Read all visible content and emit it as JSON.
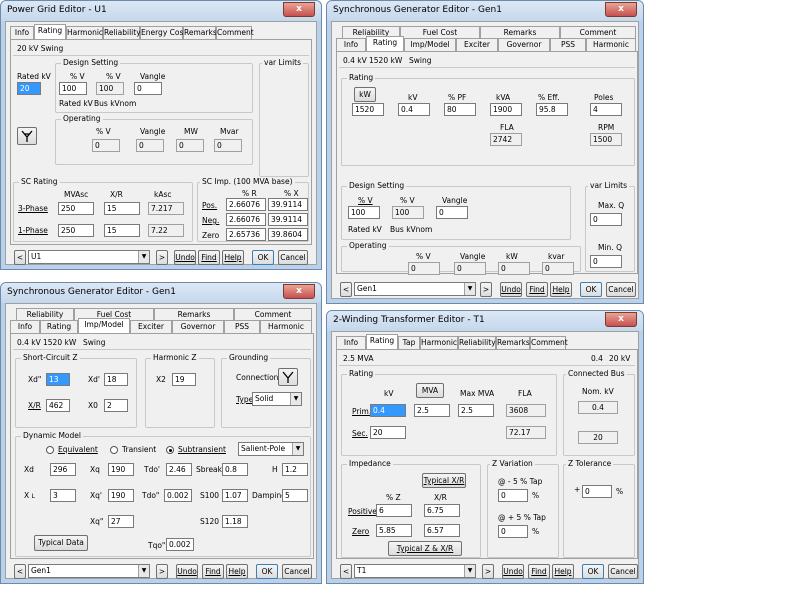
{
  "pg": {
    "title": "Power Grid Editor - U1",
    "close": "x",
    "tabs": [
      "Info",
      "Rating",
      "Harmonic",
      "Reliability",
      "Energy Cost",
      "Remarks",
      "Comment"
    ],
    "header": "20 kV  Swing",
    "rated_kv_label": "Rated kV",
    "rated_kv": "20",
    "design_setting": "Design Setting",
    "pct_v_label": "% V",
    "pct_v2_label": "% V",
    "vangle_label": "Vangle",
    "design_v": "100",
    "design_v2": "100",
    "design_vangle": "0",
    "rated_kv_sub": "Rated kV",
    "bus_kvnom": "Bus kVnom",
    "var_limits": "var Limits",
    "operating": "Operating",
    "op_pct_v": "% V",
    "op_vangle": "Vangle",
    "op_mw": "MW",
    "op_mvar": "Mvar",
    "op_v": "0",
    "op_vang": "0",
    "op_mw_val": "0",
    "op_mvar_val": "0",
    "sc_rating": "SC Rating",
    "mvasc": "MVAsc",
    "xr": "X/R",
    "kasc": "kAsc",
    "three_phase": "3-Phase",
    "three_mvasc": "250",
    "three_xr": "15",
    "three_kasc": "7.217",
    "one_phase": "1-Phase",
    "one_mvasc": "250",
    "one_xr": "15",
    "one_kasc": "7.22",
    "sc_imp": "SC Imp. (100 MVA base)",
    "pct_r": "% R",
    "pct_x": "% X",
    "pos": "Pos.",
    "pos_r": "2.66076",
    "pos_x": "39.9114",
    "neg": "Neg.",
    "neg_r": "2.66076",
    "neg_x": "39.9114",
    "zero": "Zero",
    "zero_r": "2.65736",
    "zero_x": "39.8604",
    "id": "U1",
    "nav_prev": "<",
    "nav_next": ">",
    "undo": "Undo",
    "find": "Find",
    "help": "Help",
    "ok": "OK",
    "cancel": "Cancel"
  },
  "sg1": {
    "title": "Synchronous Generator Editor - Gen1",
    "close": "x",
    "tabs_top": [
      "Reliability",
      "Fuel Cost",
      "Remarks",
      "Comment"
    ],
    "tabs_bottom": [
      "Info",
      "Rating",
      "Imp/Model",
      "Exciter",
      "Governor",
      "PSS",
      "Harmonic"
    ],
    "header_kv": "0.4 kV",
    "header_kw": "1520 kW",
    "header_mode": "Swing",
    "rating": "Rating",
    "kw_btn": "kW",
    "kv_label": "kV",
    "pf_label": "% PF",
    "kva_label": "kVA",
    "eff_label": "% Eff.",
    "poles_label": "Poles",
    "kw": "1520",
    "kv": "0.4",
    "pf": "80",
    "kva": "1900",
    "eff": "95.8",
    "poles": "4",
    "fla_label": "FLA",
    "fla": "2742",
    "rpm_label": "RPM",
    "rpm": "1500",
    "design_setting": "Design Setting",
    "pct_v": "% V",
    "pct_v2": "% V",
    "vangle": "Vangle",
    "dv": "100",
    "dv2": "100",
    "dvang": "0",
    "rated_kv": "Rated kV",
    "bus_kvnom": "Bus kVnom",
    "var_limits": "var Limits",
    "maxq_label": "Max. Q",
    "maxq": "0",
    "minq_label": "Min. Q",
    "minq": "0",
    "operating": "Operating",
    "op_pct_v": "% V",
    "op_vangle": "Vangle",
    "op_kw": "kW",
    "op_kvar": "kvar",
    "op_v": "0",
    "op_vang": "0",
    "op_kw_val": "0",
    "op_kvar_val": "0",
    "id": "Gen1",
    "nav_prev": "<",
    "nav_next": ">",
    "undo": "Undo",
    "find": "Find",
    "help": "Help",
    "ok": "OK",
    "cancel": "Cancel"
  },
  "sg2": {
    "title": "Synchronous Generator Editor - Gen1",
    "close": "x",
    "tabs_top": [
      "Reliability",
      "Fuel Cost",
      "Remarks",
      "Comment"
    ],
    "tabs_bottom": [
      "Info",
      "Rating",
      "Imp/Model",
      "Exciter",
      "Governor",
      "PSS",
      "Harmonic"
    ],
    "header_kv": "0.4 kV",
    "header_kw": "1520 kW",
    "header_mode": "Swing",
    "sc_z": "Short-Circuit Z",
    "xd2_label": "Xd\"",
    "xd2": "13",
    "xd1_label": "Xd'",
    "xd1": "18",
    "xr_label": "X/R",
    "xr": "462",
    "x0_label": "X0",
    "x0": "2",
    "harm_z": "Harmonic Z",
    "x2_label": "X2",
    "x2": "19",
    "grounding": "Grounding",
    "connection": "Connection",
    "type_label": "Type",
    "type": "Solid",
    "dyn_model": "Dynamic Model",
    "equivalent": "Equivalent",
    "transient": "Transient",
    "subtransient": "Subtransient",
    "rotor": "Salient-Pole",
    "xd_label": "Xd",
    "xd": "296",
    "xq_label": "Xq",
    "xq": "190",
    "tdo1_label": "Tdo'",
    "tdo1": "2.46",
    "sbreak_label": "Sbreak",
    "sbreak": "0.8",
    "h_label": "H",
    "h": "1.2",
    "xl_label": "X",
    "xl_sub": "L",
    "xl": "3",
    "xq1_label": "Xq'",
    "xq1": "190",
    "tdo2_label": "Tdo\"",
    "tdo2": "0.002",
    "s100_label": "S100",
    "s100": "1.07",
    "damping_label": "Damping",
    "damping": "5",
    "xq2_label": "Xq\"",
    "xq2": "27",
    "s120_label": "S120",
    "s120": "1.18",
    "typical_data": "Typical Data",
    "tqo2_label": "Tqo\"",
    "tqo2": "0.002",
    "id": "Gen1",
    "nav_prev": "<",
    "nav_next": ">",
    "undo": "Undo",
    "find": "Find",
    "help": "Help",
    "ok": "OK",
    "cancel": "Cancel"
  },
  "tx": {
    "title": "2-Winding Transformer Editor - T1",
    "close": "x",
    "tabs": [
      "Info",
      "Rating",
      "Tap",
      "Harmonic",
      "Reliability",
      "Remarks",
      "Comment"
    ],
    "header_mva": "2.5 MVA",
    "header_kv": "0.4",
    "header_kv2": "20 kV",
    "rating": "Rating",
    "kv_label": "kV",
    "mva_btn": "MVA",
    "max_mva_label": "Max MVA",
    "fla_label": "FLA",
    "prim_label": "Prim.",
    "prim_kv": "0.4",
    "mva": "2.5",
    "max_mva": "2.5",
    "prim_fla": "3608",
    "sec_label": "Sec.",
    "sec_kv": "20",
    "sec_fla": "72.17",
    "connected_bus": "Connected Bus",
    "nom_kv_label": "Nom. kV",
    "nom_kv1": "0.4",
    "nom_kv2": "20",
    "impedance": "Impedance",
    "typical_xr": "Typical X/R",
    "pct_z_label": "% Z",
    "xr_label": "X/R",
    "positive_label": "Positive",
    "pos_z": "6",
    "pos_xr": "6.75",
    "zero_label": "Zero",
    "zero_z": "5.85",
    "zero_xr": "6.57",
    "typical_zxr": "Typical Z & X/R",
    "z_variation": "Z Variation",
    "minus5": "@ - 5 % Tap",
    "minus5_val": "0",
    "plus5": "@ + 5 % Tap",
    "plus5_val": "0",
    "pct": "%",
    "z_tolerance": "Z Tolerance",
    "tol_sign": "+",
    "tol_val": "0",
    "tol_pct": "%",
    "id": "T1",
    "nav_prev": "<",
    "nav_next": ">",
    "undo": "Undo",
    "find": "Find",
    "help": "Help",
    "ok": "OK",
    "cancel": "Cancel"
  }
}
